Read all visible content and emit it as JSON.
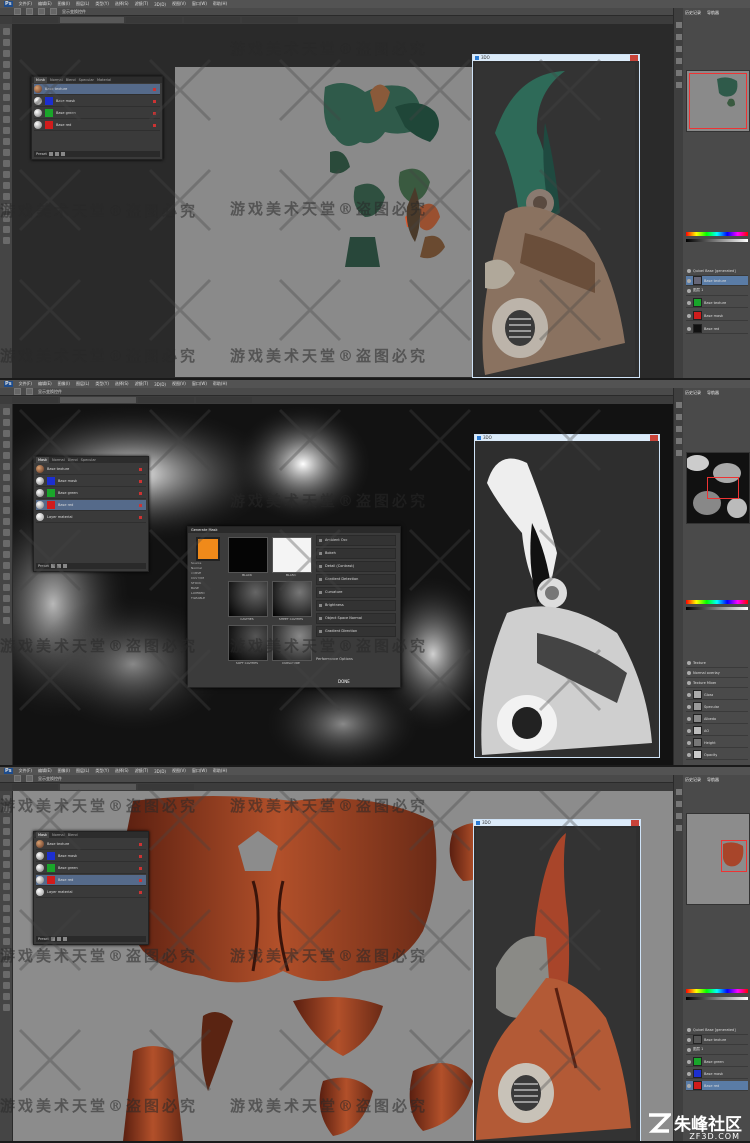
{
  "app": {
    "logo": "Ps"
  },
  "menu": [
    "文件(F)",
    "编辑(E)",
    "图像(I)",
    "图层(L)",
    "类型(Y)",
    "选择(S)",
    "滤镜(T)",
    "3D(D)",
    "视图(V)",
    "窗口(W)",
    "帮助(H)"
  ],
  "options": {
    "show_transform": "显示变换控件"
  },
  "right_panel": {
    "tab_history": "历史记录",
    "tab_navigator": "导航器"
  },
  "quixel": {
    "tabs": [
      "Mask",
      "Normal",
      "Blend",
      "Specular",
      "Material"
    ],
    "rows_top": [
      "Base texture",
      "Base mask",
      "Base green",
      "Base red"
    ],
    "rows_mid": [
      "Base texture",
      "Base mask",
      "Base green",
      "Base red",
      "Layer material"
    ],
    "rows_bot": [
      "Base texture",
      "Base mask",
      "Base green",
      "Base red",
      "Layer material"
    ],
    "preset_label": "Preset"
  },
  "viewer": {
    "title": "3DO"
  },
  "filter": {
    "title": "Generate Mask",
    "categories": [
      "Source",
      "Normal",
      "CURVE",
      "CUSTOM",
      "STOCK",
      "BASE",
      "LAYERED",
      "TILEABLE"
    ],
    "tiles": [
      "BLACK",
      "BLANK",
      "CAVITIES",
      "SHEET CAVITIES",
      "SOFT CAVITIES",
      "CURVATURE"
    ],
    "options": [
      "Ambient Occ",
      "Bokeh",
      "Detail (Contrast)",
      "Gradient Detection",
      "Curvature",
      "Brightness",
      "Object Space Normal",
      "Gradient Direction"
    ],
    "footer_text": "Performance Options",
    "done": "DONE"
  },
  "layers": {
    "top": [
      "Quixel Base [generated]",
      "Base texture",
      "图层 1",
      "Base texture",
      "Base mask",
      "Base red"
    ],
    "mid": [
      "Texture",
      "Normal overlay",
      "Texture Mixer",
      "Gloss",
      "Specular",
      "Albedo",
      "AO",
      "Height",
      "Opacity"
    ],
    "bot": [
      "Quixel Base [generated]",
      "Base texture",
      "图层 1",
      "Base green",
      "Base mask",
      "Base red"
    ]
  },
  "watermark": {
    "text_a": "游戏美术天堂",
    "mark": "®",
    "text_b": "盗图必究"
  },
  "brand": {
    "name": "朱峰社区",
    "url": "ZF3D.COM"
  },
  "colors": {
    "ps_bg": "#3c3c3c",
    "accent": "#5a7ca6",
    "close": "#c9443a"
  }
}
